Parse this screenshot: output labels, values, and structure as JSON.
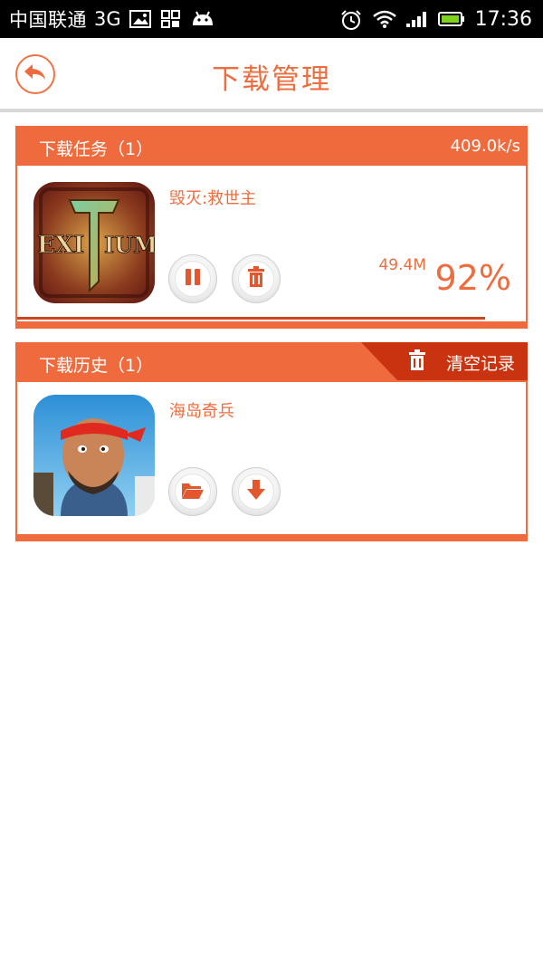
{
  "statusbar": {
    "carrier": "中国联通",
    "network": "3G",
    "time": "17:36",
    "icons": [
      "image-icon",
      "grid-icon",
      "android-icon",
      "alarm-icon",
      "wifi-icon",
      "signal-icon",
      "battery-icon"
    ]
  },
  "appbar": {
    "title": "下载管理",
    "back_icon": "back-arrow-icon"
  },
  "colors": {
    "accent": "#ef6b3e",
    "accent_dark": "#c9461e",
    "divider": "#d8d8d8"
  },
  "downloading": {
    "header": "下载任务（1）",
    "speed": "409.0k/s",
    "items": [
      {
        "name": "毁灭:救世主",
        "icon": "exitium-game-icon",
        "size": "49.4M",
        "percent_label": "92%",
        "progress": 0.92,
        "actions": [
          "pause-icon",
          "trash-icon"
        ]
      }
    ]
  },
  "history": {
    "header": "下载历史（1）",
    "clear_label": "清空记录",
    "clear_icon": "trash-icon",
    "items": [
      {
        "name": "海岛奇兵",
        "icon": "boom-beach-game-icon",
        "actions": [
          "folder-icon",
          "download-arrow-icon"
        ]
      }
    ]
  }
}
